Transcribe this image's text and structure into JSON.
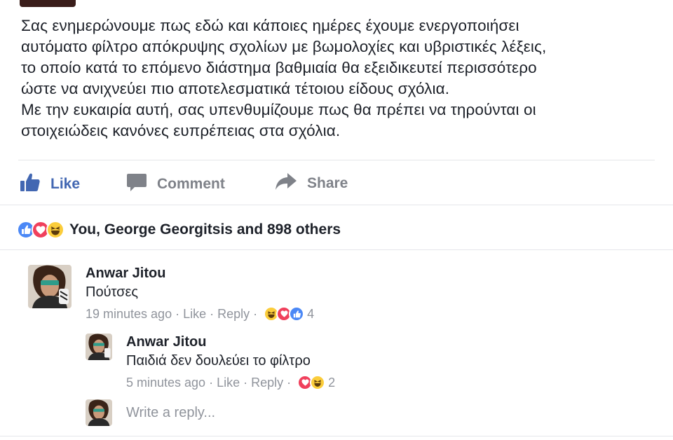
{
  "post": {
    "lines": [
      "Σας ενημερώνουμε πως εδώ και κάποιες ημέρες έχουμε ενεργοποιήσει",
      "αυτόματο φίλτρο απόκρυψης σχολίων με βωμολοχίες και υβριστικές λέξεις,",
      "το οποίο κατά το επόμενο διάστημα βαθμιαία θα εξειδικευτεί περισσότερο",
      "ώστε να ανιχνεύει πιο αποτελεσματικά τέτοιου είδους σχόλια.",
      "Με την ευκαιρία αυτή, σας υπενθυμίζουμε πως θα πρέπει να τηρούνται οι",
      "στοιχειώδεις κανόνες ευπρέπειας στα σχόλια."
    ]
  },
  "actions": {
    "like_label": "Like",
    "comment_label": "Comment",
    "share_label": "Share",
    "like_icon": "thumbs-up-icon",
    "comment_icon": "speech-bubble-icon",
    "share_icon": "share-arrow-icon"
  },
  "reactions_summary": {
    "text": "You, George Georgitsis and 898 others",
    "icons": [
      "like",
      "love",
      "haha"
    ]
  },
  "comments": [
    {
      "author": "Anwar Jitou",
      "text": "Πούτσες",
      "time": "19 minutes ago",
      "like_label": "Like",
      "reply_label": "Reply",
      "reaction_icons": [
        "haha",
        "love",
        "like"
      ],
      "reaction_count": "4"
    },
    {
      "author": "Anwar Jitou",
      "text": "Παιδιά δεν δουλεύει το φίλτρο",
      "time": "5 minutes ago",
      "like_label": "Like",
      "reply_label": "Reply",
      "reaction_icons": [
        "love",
        "haha"
      ],
      "reaction_count": "2"
    }
  ],
  "reply_box": {
    "placeholder": "Write a reply..."
  },
  "colors": {
    "like_blue": "#4267b2",
    "love_red": "#f0405c",
    "haha_yellow": "#fbcd3b",
    "meta_gray": "#90949c"
  }
}
